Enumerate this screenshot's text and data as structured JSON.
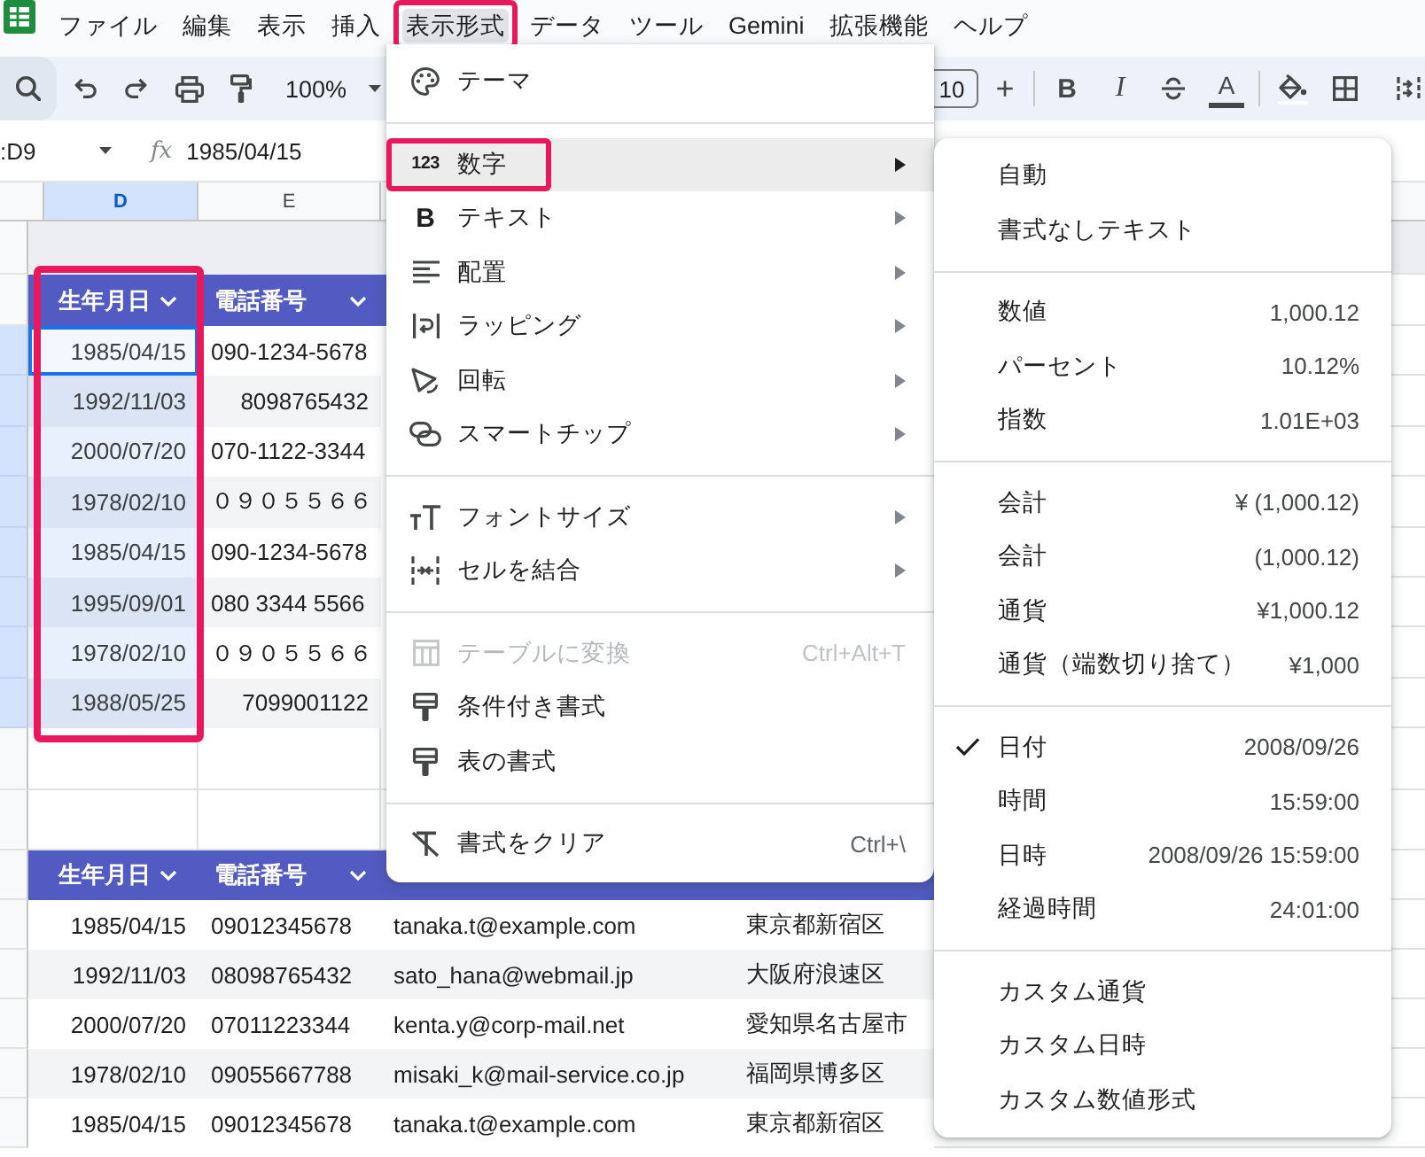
{
  "menubar": {
    "items": [
      {
        "label": "ファイル",
        "selected": false,
        "highlighted": false
      },
      {
        "label": "編集",
        "selected": false,
        "highlighted": false
      },
      {
        "label": "表示",
        "selected": false,
        "highlighted": false
      },
      {
        "label": "挿入",
        "selected": false,
        "highlighted": false
      },
      {
        "label": "表示形式",
        "selected": true,
        "highlighted": true
      },
      {
        "label": "データ",
        "selected": false,
        "highlighted": false
      },
      {
        "label": "ツール",
        "selected": false,
        "highlighted": false
      },
      {
        "label": "Gemini",
        "selected": false,
        "highlighted": false
      },
      {
        "label": "拡張機能",
        "selected": false,
        "highlighted": false
      },
      {
        "label": "ヘルプ",
        "selected": false,
        "highlighted": false
      }
    ]
  },
  "toolbar": {
    "zoom": "100%",
    "font_size": "10",
    "increase_font_size": "+",
    "bold": "B",
    "italic": "I",
    "text_color": "A"
  },
  "formula_bar": {
    "cell_reference": ":D9",
    "function_label": "fx",
    "value": "1985/04/15"
  },
  "sheet": {
    "column_headers": [
      {
        "label": "D",
        "selected": true
      },
      {
        "label": "E",
        "selected": false
      }
    ],
    "top_table": {
      "columns": [
        {
          "label": "生年月日",
          "selected": true,
          "highlighted": true
        },
        {
          "label": "電話番号",
          "selected": false,
          "highlighted": false
        }
      ],
      "rows": [
        {
          "active": true,
          "cells": [
            {
              "text": "1985/04/15",
              "kind": "date"
            },
            {
              "text": "090-1234-5678",
              "kind": "text"
            }
          ]
        },
        {
          "active": false,
          "cells": [
            {
              "text": "1992/11/03",
              "kind": "date"
            },
            {
              "text": "8098765432",
              "kind": "number"
            }
          ]
        },
        {
          "active": false,
          "cells": [
            {
              "text": "2000/07/20",
              "kind": "date"
            },
            {
              "text": "070-1122-3344",
              "kind": "text"
            }
          ]
        },
        {
          "active": false,
          "cells": [
            {
              "text": "1978/02/10",
              "kind": "date"
            },
            {
              "text": "０９０５５６６",
              "kind": "text"
            }
          ]
        },
        {
          "active": false,
          "cells": [
            {
              "text": "1985/04/15",
              "kind": "date"
            },
            {
              "text": "090-1234-5678",
              "kind": "text"
            }
          ]
        },
        {
          "active": false,
          "cells": [
            {
              "text": "1995/09/01",
              "kind": "date"
            },
            {
              "text": "080 3344 5566",
              "kind": "text"
            }
          ]
        },
        {
          "active": false,
          "cells": [
            {
              "text": "1978/02/10",
              "kind": "date"
            },
            {
              "text": "０９０５５６６",
              "kind": "text"
            }
          ]
        },
        {
          "active": false,
          "cells": [
            {
              "text": "1988/05/25",
              "kind": "date"
            },
            {
              "text": "7099001122",
              "kind": "number"
            }
          ]
        }
      ]
    },
    "bottom_table": {
      "columns": [
        {
          "label": "生年月日"
        },
        {
          "label": "電話番号"
        }
      ],
      "rows": [
        {
          "cells": [
            {
              "text": "1985/04/15",
              "kind": "date"
            },
            {
              "text": "09012345678",
              "kind": "text"
            },
            {
              "text": "tanaka.t@example.com",
              "kind": "text"
            },
            {
              "text": "東京都新宿区",
              "kind": "text"
            }
          ]
        },
        {
          "cells": [
            {
              "text": "1992/11/03",
              "kind": "date"
            },
            {
              "text": "08098765432",
              "kind": "text"
            },
            {
              "text": "sato_hana@webmail.jp",
              "kind": "text"
            },
            {
              "text": "大阪府浪速区",
              "kind": "text"
            }
          ]
        },
        {
          "cells": [
            {
              "text": "2000/07/20",
              "kind": "date"
            },
            {
              "text": "07011223344",
              "kind": "text"
            },
            {
              "text": "kenta.y@corp-mail.net",
              "kind": "text"
            },
            {
              "text": "愛知県名古屋市",
              "kind": "text"
            }
          ]
        },
        {
          "cells": [
            {
              "text": "1978/02/10",
              "kind": "date"
            },
            {
              "text": "09055667788",
              "kind": "text"
            },
            {
              "text": "misaki_k@mail-service.co.jp",
              "kind": "text"
            },
            {
              "text": "福岡県博多区",
              "kind": "text"
            }
          ]
        },
        {
          "cells": [
            {
              "text": "1985/04/15",
              "kind": "date"
            },
            {
              "text": "09012345678",
              "kind": "text"
            },
            {
              "text": "tanaka.t@example.com",
              "kind": "text"
            },
            {
              "text": "東京都新宿区",
              "kind": "text"
            }
          ]
        }
      ]
    }
  },
  "format_menu": {
    "groups": [
      {
        "items": [
          {
            "label": "テーマ",
            "selected": false,
            "disabled": false,
            "highlighted": false,
            "has_submenu": false
          }
        ]
      },
      {
        "items": [
          {
            "label": "数字",
            "glyph": "123",
            "selected": true,
            "disabled": false,
            "highlighted": true,
            "has_submenu": true
          },
          {
            "label": "テキスト",
            "glyph": "B",
            "selected": false,
            "disabled": false,
            "highlighted": false,
            "has_submenu": true
          },
          {
            "label": "配置",
            "selected": false,
            "disabled": false,
            "highlighted": false,
            "has_submenu": true
          },
          {
            "label": "ラッピング",
            "selected": false,
            "disabled": false,
            "highlighted": false,
            "has_submenu": true
          },
          {
            "label": "回転",
            "selected": false,
            "disabled": false,
            "highlighted": false,
            "has_submenu": true
          },
          {
            "label": "スマートチップ",
            "selected": false,
            "disabled": false,
            "highlighted": false,
            "has_submenu": true
          }
        ]
      },
      {
        "items": [
          {
            "label": "フォントサイズ",
            "selected": false,
            "disabled": false,
            "highlighted": false,
            "has_submenu": true
          },
          {
            "label": "セルを結合",
            "selected": false,
            "disabled": false,
            "highlighted": false,
            "has_submenu": true
          }
        ]
      },
      {
        "items": [
          {
            "label": "テーブルに変換",
            "shortcut": "Ctrl+Alt+T",
            "selected": false,
            "disabled": true,
            "highlighted": false,
            "has_submenu": false
          },
          {
            "label": "条件付き書式",
            "selected": false,
            "disabled": false,
            "highlighted": false,
            "has_submenu": false
          },
          {
            "label": "表の書式",
            "selected": false,
            "disabled": false,
            "highlighted": false,
            "has_submenu": false
          }
        ]
      },
      {
        "items": [
          {
            "label": "書式をクリア",
            "shortcut": "Ctrl+\\",
            "selected": false,
            "disabled": false,
            "highlighted": false,
            "has_submenu": false
          }
        ]
      }
    ]
  },
  "number_format_submenu": {
    "groups": [
      {
        "items": [
          {
            "label": "自動",
            "checked": false
          },
          {
            "label": "書式なしテキスト",
            "checked": false
          }
        ]
      },
      {
        "items": [
          {
            "label": "数値",
            "example": "1,000.12",
            "checked": false
          },
          {
            "label": "パーセント",
            "example": "10.12%",
            "checked": false
          },
          {
            "label": "指数",
            "example": "1.01E+03",
            "checked": false
          }
        ]
      },
      {
        "items": [
          {
            "label": "会計",
            "example": "¥ (1,000.12)",
            "checked": false
          },
          {
            "label": "会計",
            "example": "(1,000.12)",
            "checked": false
          },
          {
            "label": "通貨",
            "example": "¥1,000.12",
            "checked": false
          },
          {
            "label": "通貨（端数切り捨て）",
            "example": "¥1,000",
            "checked": false
          }
        ]
      },
      {
        "items": [
          {
            "label": "日付",
            "example": "2008/09/26",
            "checked": true
          },
          {
            "label": "時間",
            "example": "15:59:00",
            "checked": false
          },
          {
            "label": "日時",
            "example": "2008/09/26 15:59:00",
            "checked": false
          },
          {
            "label": "経過時間",
            "example": "24:01:00",
            "checked": false
          }
        ]
      },
      {
        "items": [
          {
            "label": "カスタム通貨",
            "checked": false
          },
          {
            "label": "カスタム日時",
            "checked": false
          },
          {
            "label": "カスタム数値形式",
            "checked": false
          }
        ]
      }
    ]
  }
}
